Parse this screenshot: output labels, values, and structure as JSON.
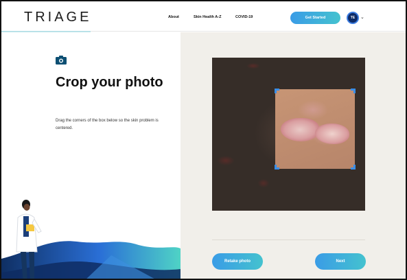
{
  "header": {
    "logo": "TRIAGE",
    "nav": [
      "About",
      "Skin Health A-Z",
      "COVID-19"
    ],
    "cta_label": "Get Started",
    "avatar_initials": "TE",
    "accent": "#3a9ce6"
  },
  "main": {
    "title": "Crop your photo",
    "description": "Drag the corners of the box below so the skin problem is centered.",
    "icons": [
      "camera-icon",
      "chevron-down-icon"
    ]
  },
  "actions": {
    "retake_label": "Retake photo",
    "next_label": "Next"
  }
}
